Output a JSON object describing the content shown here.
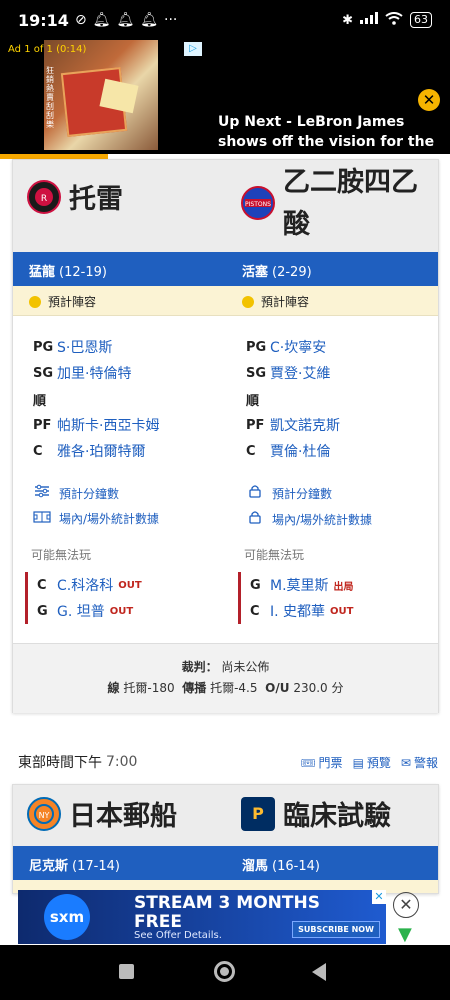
{
  "status_bar": {
    "time": "19:14",
    "dnd": "ⓩ",
    "more": "···",
    "battery": "63"
  },
  "top_ad": {
    "label": "Ad 1 of 1 (0:14)",
    "headline": "Up Next - LeBron James shows off the vision for the slick...",
    "close": "✕",
    "choice": "▷",
    "side_text": "狂銷熱賣刮刮樂"
  },
  "game1": {
    "away": {
      "name": "托雷",
      "short": "猛龍",
      "record": "(12-19)",
      "status": "預計陣容",
      "lineup": [
        {
          "pos": "PG",
          "name": "S·巴恩斯"
        },
        {
          "pos": "SG",
          "name": "加里·特倫特"
        },
        {
          "pos": "順",
          "name": ""
        },
        {
          "pos": "PF",
          "name": "帕斯卡·西亞卡姆"
        },
        {
          "pos": "C",
          "name": "雅各·珀爾特爾"
        }
      ],
      "links": [
        "預計分鐘數",
        "場內/場外統計數據"
      ],
      "injury_label": "可能無法玩",
      "injuries": [
        {
          "pos": "C",
          "name": "C.科洛科",
          "status": "OUT"
        },
        {
          "pos": "G",
          "name": "G. 坦普",
          "status": "OUT"
        }
      ]
    },
    "home": {
      "name": "乙二胺四乙酸",
      "short": "活塞",
      "record": "(2-29)",
      "status": "預計陣容",
      "lineup": [
        {
          "pos": "PG",
          "name": "C·坎寧安"
        },
        {
          "pos": "SG",
          "name": "賈登·艾維"
        },
        {
          "pos": "順",
          "name": ""
        },
        {
          "pos": "PF",
          "name": "凱文諾克斯"
        },
        {
          "pos": "C",
          "name": "賈倫·杜倫"
        }
      ],
      "links": [
        "預計分鐘數",
        "場內/場外統計數據"
      ],
      "injury_label": "可能無法玩",
      "injuries": [
        {
          "pos": "G",
          "name": "M.莫里斯",
          "status": "出局"
        },
        {
          "pos": "C",
          "name": "I. 史都華",
          "status": "OUT"
        }
      ]
    },
    "footer": {
      "referee_label": "裁判：",
      "referee_value": "尚未公佈",
      "line_label": "線",
      "line_value": "托爾-180",
      "spread_label": "傳播",
      "spread_value": "托爾-4.5",
      "ou_label": "O/U",
      "ou_value": "230.0 分"
    }
  },
  "time_row": {
    "label": "東部時間下午",
    "time": "7:00",
    "tickets": "門票",
    "preview": "預覽",
    "alert": "警報"
  },
  "game2": {
    "away": {
      "name": "日本郵船",
      "short": "尼克斯",
      "record": "(17-14)"
    },
    "home": {
      "name": "臨床試驗",
      "short": "溜馬",
      "record": "(16-14)"
    }
  },
  "bottom_ad": {
    "logo": "sxm",
    "line1": "STREAM 3 MONTHS",
    "line1b": "FREE",
    "line2": "See Offer Details.",
    "button": "SUBSCRIBE NOW",
    "close": "✕",
    "choice": "✕"
  },
  "colors": {
    "accent": "#1f5fbf",
    "out": "#c0261e",
    "injury_bar": "#b3202a",
    "ad_yellow": "#f6b400"
  },
  "icons": [
    "dnd-icon",
    "bell-icon",
    "bluetooth-icon",
    "signal-icon",
    "wifi-icon",
    "battery-icon",
    "sliders-icon",
    "lock-icon",
    "court-icon",
    "ticket-icon",
    "document-icon",
    "mail-icon"
  ]
}
